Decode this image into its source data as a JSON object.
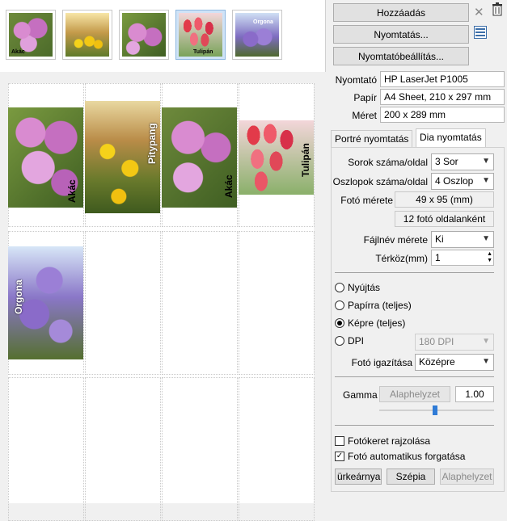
{
  "thumbnails": [
    {
      "name": "akac",
      "caption": "Akác",
      "selected": false
    },
    {
      "name": "pitypang",
      "caption": "",
      "selected": false
    },
    {
      "name": "akac-2",
      "caption": "",
      "selected": false
    },
    {
      "name": "tulipan",
      "caption": "Tulipán",
      "selected": true
    },
    {
      "name": "orgona",
      "caption": "Orgona",
      "selected": false
    }
  ],
  "preview_photos": {
    "akac_1": "Akác",
    "pitypang": "Pitypang",
    "akac_2": "Akác",
    "tulipan": "Tulipán",
    "orgona": "Orgona"
  },
  "buttons": {
    "add": "Hozzáadás",
    "print": "Nyomtatás...",
    "printer_settings": "Nyomtatóbeállítás..."
  },
  "icons": {
    "remove": "close-x-icon",
    "trash": "trash-icon",
    "layout": "layout-icon"
  },
  "printer_info": {
    "printer_label": "Nyomtató",
    "printer_value": "HP LaserJet P1005",
    "paper_label": "Papír",
    "paper_value": "A4 Sheet, 210 x 297 mm",
    "size_label": "Méret",
    "size_value": "200 x 289 mm"
  },
  "tabs": [
    {
      "label": "Portré nyomtatás",
      "active": false
    },
    {
      "label": "Dia nyomtatás",
      "active": true
    }
  ],
  "slide_print": {
    "rows_label": "Sorok száma/oldal",
    "rows_value": "3 Sor",
    "cols_label": "Oszlopok száma/oldal",
    "cols_value": "4 Oszlop",
    "photo_size_label": "Fotó mérete",
    "photo_size_value": "49 x 95 (mm)",
    "photos_per_page": "12 fotó oldalanként",
    "filename_size_label": "Fájlnév mérete",
    "filename_size_value": "Ki",
    "spacing_label": "Térköz(mm)",
    "spacing_value": "1",
    "radio_stretch": "Nyújtás",
    "radio_paper": "Papírra (teljes)",
    "radio_image": "Képre (teljes)",
    "radio_dpi": "DPI",
    "dpi_value": "180 DPI",
    "align_label": "Fotó igazítása",
    "align_value": "Középre",
    "gamma_label": "Gamma",
    "gamma_reset": "Alaphelyzet",
    "gamma_value": "1.00",
    "gamma_slider": 0.5,
    "checkbox_frame": "Fotókeret rajzolása",
    "checkbox_frame_checked": false,
    "checkbox_rotate": "Fotó automatikus forgatása",
    "checkbox_rotate_checked": true,
    "btn_grayscale": "ürkeárnya",
    "btn_sepia": "Szépia",
    "btn_reset": "Alaphelyzet"
  }
}
